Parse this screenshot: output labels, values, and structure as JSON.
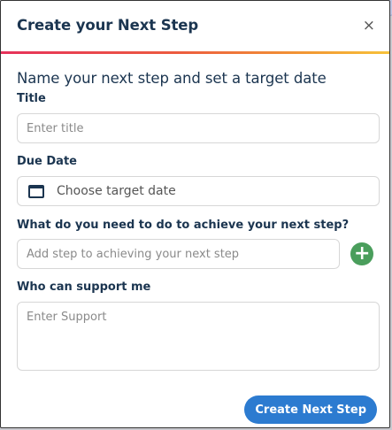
{
  "modal": {
    "title": "Create your Next Step",
    "close_glyph": "×",
    "subheading": "Name your next step and set a target date"
  },
  "fields": {
    "title_label": "Title",
    "title_placeholder": "Enter title",
    "due_date_label": "Due Date",
    "due_date_placeholder": "Choose target date",
    "steps_label": "What do you need to do to achieve your next step?",
    "steps_placeholder": "Add step to achieving your next step",
    "support_label": "Who can support me",
    "support_placeholder": "Enter Support"
  },
  "buttons": {
    "add_glyph": "+",
    "submit_label": "Create Next Step"
  },
  "colors": {
    "heading": "#1b3550",
    "accent_blue": "#2c7bd0",
    "add_green": "#4a9e5c",
    "gradient": [
      "#e6315b",
      "#ec5b3f",
      "#f29a33",
      "#f7c23a"
    ]
  },
  "icons": {
    "close": "close-icon",
    "calendar": "calendar-icon",
    "add": "plus-circle-icon"
  }
}
